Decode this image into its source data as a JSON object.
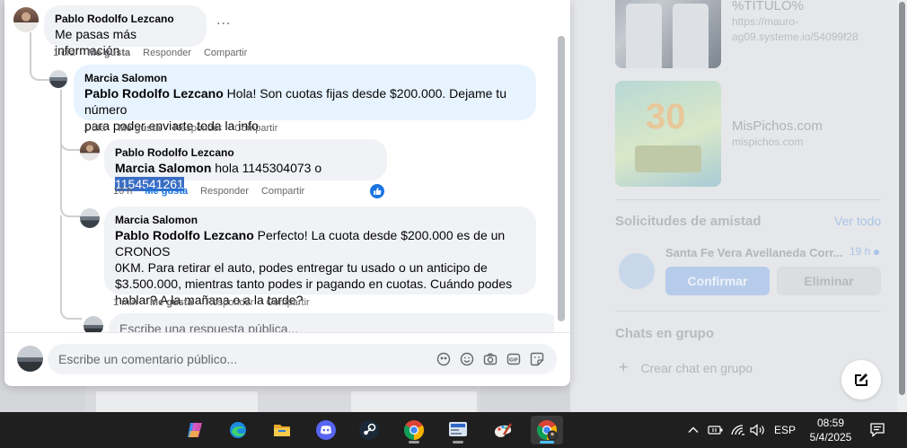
{
  "ads": [
    {
      "title": "%TITULO%",
      "url_line1": "https://mauro-",
      "url_line2": "ag09.systeme.io/54099f28"
    },
    {
      "title": "MisPichos.com",
      "url": "mispichos.com",
      "thumb_text": "30"
    }
  ],
  "friend_requests": {
    "title": "Solicitudes de amistad",
    "see_all": "Ver todo",
    "name": "Santa Fe Vera Avellaneda Corr...",
    "time": "19 h",
    "confirm": "Confirmar",
    "delete": "Eliminar"
  },
  "group_chats": {
    "title": "Chats en grupo",
    "create": "Crear chat en grupo"
  },
  "comments": [
    {
      "author": "Pablo Rodolfo Lezcano",
      "text": "Me pasas más información",
      "time": "1 día",
      "like": "Me gusta",
      "reply": "Responder",
      "share": "Compartir",
      "more": "..."
    },
    {
      "author": "Marcia Salomon",
      "mention": "Pablo Rodolfo Lezcano",
      "text_line1": " Hola! Son cuotas fijas desde $200.000. Dejame tu número",
      "text_line2": "para poder enviarte toda la info",
      "time": "1 día",
      "like": "Me gusta",
      "reply": "Responder",
      "share": "Compartir"
    },
    {
      "author": "Pablo Rodolfo Lezcano",
      "mention": "Marcia Salomon",
      "text": " hola 1145304073 o ",
      "selected": "1154541261",
      "time": "16 h",
      "like": "Me gusta",
      "reply": "Responder",
      "share": "Compartir"
    },
    {
      "author": "Marcia Salomon",
      "mention": "Pablo Rodolfo Lezcano",
      "text_line1": " Perfecto! La cuota desde $200.000 es de un CRONOS",
      "text_line2": "0KM. Para retirar el auto, podes entregar tu usado o un anticipo de",
      "text_line3": "$3.500.000, mientras tanto podes ir pagando en cuotas. Cuándo podes",
      "text_line4": "hablar? A la mañana o a la tarde?",
      "time": "1 min",
      "like": "Me gusta",
      "reply": "Responder",
      "share": "Compartir"
    }
  ],
  "reply_placeholder": "Escribe una respuesta pública...",
  "comment_placeholder": "Escribe un comentario público...",
  "taskbar": {
    "apps": [
      "copilot-icon",
      "edge-icon",
      "file-explorer-icon",
      "discord-icon",
      "steam-icon",
      "chrome-icon",
      "news-icon",
      "paint-icon",
      "chrome-profile-icon"
    ],
    "lang": "ESP",
    "time": "08:59",
    "date": "5/4/2025"
  },
  "colors": {
    "facebook_blue": "#1b74e4",
    "selection": "#3a6ec4",
    "reply_bubble": "#e7f3ff",
    "comment_bubble": "#f0f2f5"
  }
}
